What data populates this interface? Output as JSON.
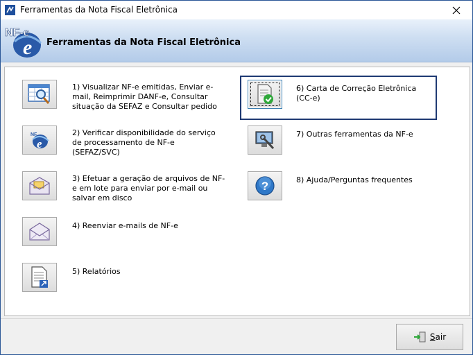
{
  "window": {
    "title": "Ferramentas da Nota Fiscal Eletrônica"
  },
  "header": {
    "logo_text": "NF-e",
    "title": "Ferramentas da Nota Fiscal Eletrônica"
  },
  "tools": [
    {
      "label": "1) Visualizar NF-e emitidas, Enviar e-mail, Reimprimir DANF-e, Consultar situação da SEFAZ e Consultar pedido",
      "icon": "magnifier-table-icon"
    },
    {
      "label": "2) Verificar disponibilidade do serviço de processamento de NF-e (SEFAZ/SVC)",
      "icon": "nfe-globe-icon"
    },
    {
      "label": "3) Efetuar a geração de arquivos de NF-e em lote para enviar por e-mail ou salvar em disco",
      "icon": "envelope-files-icon"
    },
    {
      "label": "4) Reenviar e-mails de NF-e",
      "icon": "envelope-icon"
    },
    {
      "label": "5) Relatórios",
      "icon": "report-document-icon"
    },
    {
      "label": "6) Carta de Correção Eletrônica (CC-e)",
      "icon": "document-check-icon"
    },
    {
      "label": "7) Outras ferramentas da NF-e",
      "icon": "tools-monitor-icon"
    },
    {
      "label": "8) Ajuda/Perguntas frequentes",
      "icon": "help-question-icon"
    }
  ],
  "footer": {
    "exit_label": "Sair"
  },
  "colors": {
    "window_border": "#2b5797",
    "header_gradient_start": "#e9f1fb",
    "header_gradient_end": "#b3cbe9",
    "highlight_border": "#1f3a73",
    "help_blue": "#2f78c8",
    "check_green": "#2fa83a"
  }
}
